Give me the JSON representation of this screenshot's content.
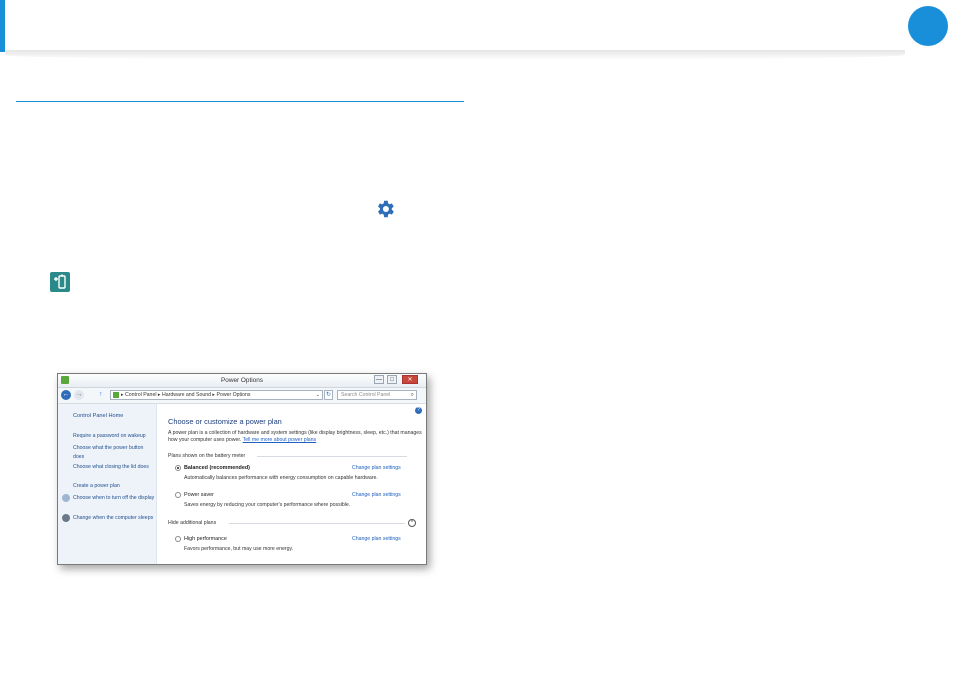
{
  "window": {
    "title": "Power Options",
    "controls": {
      "minimize": "—",
      "maximize": "□",
      "close": "✕"
    }
  },
  "address_bar": {
    "back": "←",
    "forward": "→",
    "up": "↑",
    "path": "▸ Control Panel ▸ Hardware and Sound ▸ Power Options",
    "dropdown": "⌄",
    "refresh": "↻",
    "search_placeholder": "Search Control Panel",
    "search_icon": "⌕"
  },
  "sidebar": {
    "home": "Control Panel Home",
    "links": [
      "Require a password on wakeup",
      "Choose what the power button does",
      "Choose what closing the lid does",
      "Create a power plan",
      "Choose when to turn off the display",
      "Change when the computer sleeps"
    ]
  },
  "main": {
    "help": "?",
    "heading": "Choose or customize a power plan",
    "description": "A power plan is a collection of hardware and system settings (like display brightness, sleep, etc.) that manages how your computer uses power.",
    "learn_more": "Tell me more about power plans",
    "group_battery": "Plans shown on the battery meter",
    "group_hidden": "Hide additional plans",
    "collapse_icon": "^",
    "plans": [
      {
        "name": "Balanced (recommended)",
        "desc": "Automatically balances performance with energy consumption on capable hardware.",
        "link": "Change plan settings",
        "selected": true
      },
      {
        "name": "Power saver",
        "desc": "Saves energy by reducing your computer's performance where possible.",
        "link": "Change plan settings",
        "selected": false
      },
      {
        "name": "High performance",
        "desc": "Favors performance, but may use more energy.",
        "link": "Change plan settings",
        "selected": false
      }
    ]
  },
  "colors": {
    "accent": "#1a8fd9",
    "link": "#1f5fbf",
    "heading": "#1e3d7a"
  }
}
